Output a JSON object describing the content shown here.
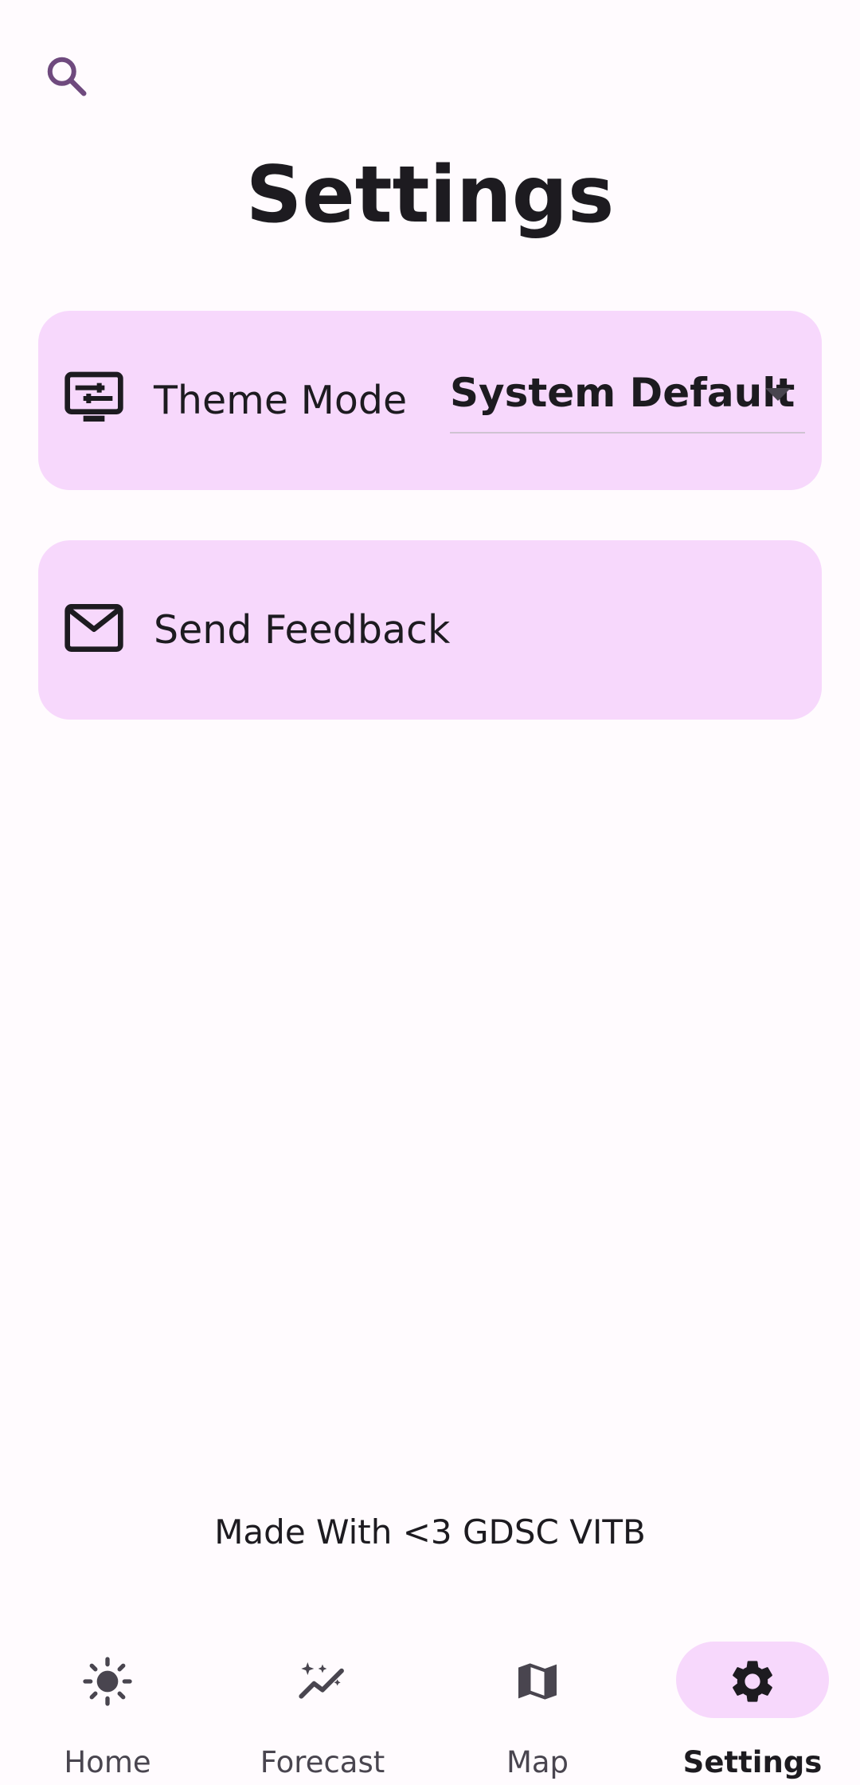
{
  "header": {
    "title": "Settings",
    "search_icon": "search-icon"
  },
  "settings": {
    "theme_mode": {
      "label": "Theme Mode",
      "icon": "display-settings-icon",
      "value": "System Default"
    },
    "feedback": {
      "label": "Send Feedback",
      "icon": "mail-icon"
    }
  },
  "footer": {
    "text": "Made With <3 GDSC VITB"
  },
  "nav": {
    "items": [
      {
        "label": "Home",
        "icon": "sun-icon"
      },
      {
        "label": "Forecast",
        "icon": "forecast-trend-icon"
      },
      {
        "label": "Map",
        "icon": "map-icon"
      },
      {
        "label": "Settings",
        "icon": "gear-icon"
      }
    ],
    "active": "Settings"
  },
  "colors": {
    "background": "#fffbfe",
    "card": "#f7d8fc",
    "accent": "#6f4a7e",
    "text": "#1d1b20"
  }
}
